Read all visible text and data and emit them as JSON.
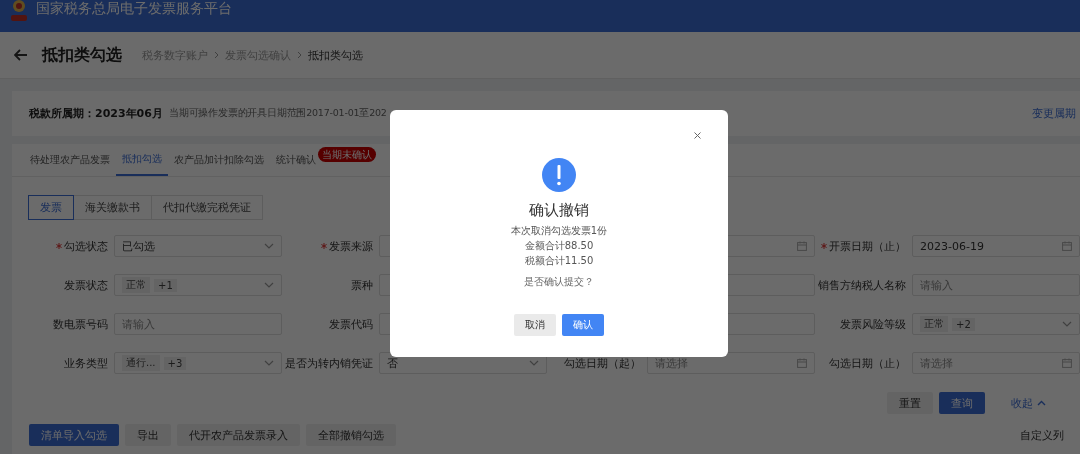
{
  "header": {
    "title": "国家税务总局电子发票服务平台"
  },
  "title_bar": {
    "title": "抵扣类勾选",
    "breadcrumb": [
      {
        "label": "税务数字账户",
        "current": false
      },
      {
        "label": "发票勾选确认",
        "current": false
      },
      {
        "label": "抵扣类勾选",
        "current": true
      }
    ]
  },
  "period": {
    "label": "税款所属期：2023年06月",
    "range": "当期可操作发票的开具日期范围2017-01-01至202",
    "change_link": "变更属期"
  },
  "tabs": [
    {
      "label": "待处理农产品发票",
      "selected": false
    },
    {
      "label": "抵扣勾选",
      "selected": true
    },
    {
      "label": "农产品加计扣除勾选",
      "selected": false
    },
    {
      "label": "统计确认",
      "selected": false,
      "badge": "当期未确认"
    }
  ],
  "sub_tabs": [
    {
      "label": "发票",
      "selected": true
    },
    {
      "label": "海关缴款书",
      "selected": false
    },
    {
      "label": "代扣代缴完税凭证",
      "selected": false
    }
  ],
  "form": [
    [
      {
        "kind": "select",
        "label": "勾选状态",
        "required": true,
        "value": "已勾选"
      },
      {
        "kind": "input",
        "label": "发票来源",
        "required": true
      },
      {
        "kind": "date"
      },
      {
        "kind": "date",
        "label": "开票日期（止）",
        "required": true,
        "value": "2023-06-19"
      }
    ],
    [
      {
        "kind": "select",
        "label": "发票状态",
        "tags": [
          "正常",
          "+1"
        ]
      },
      {
        "kind": "input",
        "label": "票种"
      },
      {
        "kind": "input"
      },
      {
        "kind": "input",
        "label": "销售方纳税人名称",
        "placeholder": "请输入"
      }
    ],
    [
      {
        "kind": "input",
        "label": "数电票号码",
        "placeholder": "请输入"
      },
      {
        "kind": "input",
        "label": "发票代码"
      },
      {
        "kind": "input"
      },
      {
        "kind": "select",
        "label": "发票风险等级",
        "tags": [
          "正常",
          "+2"
        ]
      }
    ],
    [
      {
        "kind": "select",
        "label": "业务类型",
        "tags": [
          "通行...",
          "+3"
        ]
      },
      {
        "kind": "select",
        "label": "是否为转内销凭证",
        "value": "否"
      },
      {
        "kind": "date",
        "label": "勾选日期（起）",
        "placeholder": "请选择"
      },
      {
        "kind": "date",
        "label": "勾选日期（止）",
        "placeholder": "请选择"
      }
    ]
  ],
  "query_buttons": [
    {
      "label": "重置",
      "kind": "default"
    },
    {
      "label": "查询",
      "kind": "primary"
    },
    {
      "label": "收起",
      "kind": "link"
    }
  ],
  "actions": [
    {
      "label": "清单导入勾选",
      "kind": "primary"
    },
    {
      "label": "导出",
      "kind": "default"
    },
    {
      "label": "代开农产品发票录入",
      "kind": "default"
    },
    {
      "label": "全部撤销勾选",
      "kind": "default"
    }
  ],
  "column_button": "自定义列",
  "dialog": {
    "title": "确认撤销",
    "lines": [
      "本次取消勾选发票1份",
      "金额合计88.50",
      "税额合计11.50"
    ],
    "question": "是否确认提交？",
    "buttons": [
      {
        "label": "取消",
        "kind": "default"
      },
      {
        "label": "确认",
        "kind": "primary"
      }
    ]
  }
}
